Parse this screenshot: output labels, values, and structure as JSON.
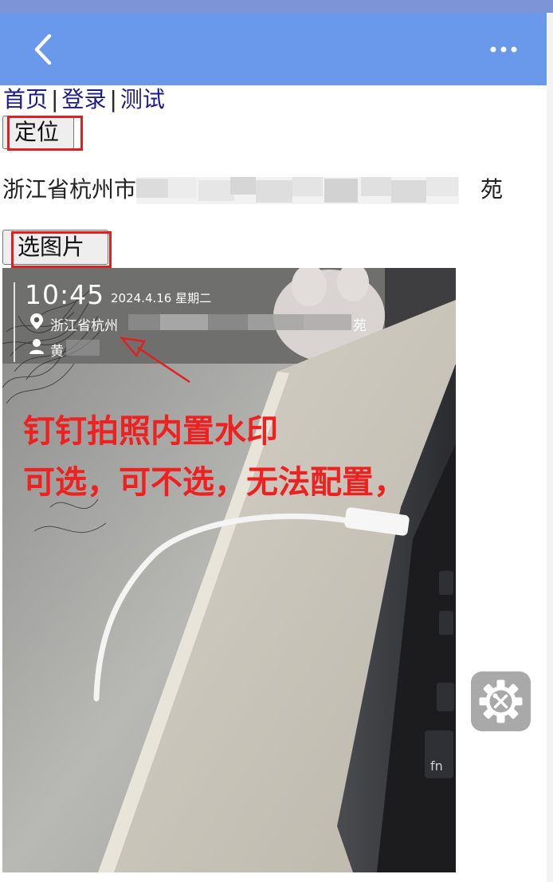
{
  "nav": {
    "back_icon": "chevron-left-icon",
    "more_icon": "more-dots-icon",
    "bar_color": "#6a98ea"
  },
  "links": [
    {
      "label": "首页"
    },
    {
      "label": "登录"
    },
    {
      "label": "测试"
    }
  ],
  "separator": "|",
  "locate_button": {
    "label": "定位"
  },
  "address": {
    "prefix": "浙江省杭州市",
    "suffix": "苑"
  },
  "pick_button": {
    "label": "选图片"
  },
  "photo": {
    "watermark": {
      "time": "10:45",
      "date": "2024.4.16 星期二",
      "location": "浙江省杭州",
      "location_suffix": "苑",
      "name": "黄"
    },
    "annotation_line1": "钉钉拍照内置水印",
    "annotation_line2": "可选，可不选，无法配置，",
    "annotation_color": "#ee2020",
    "key_label": "fn"
  },
  "settings_fab": {
    "icon": "gear-tools-icon"
  }
}
